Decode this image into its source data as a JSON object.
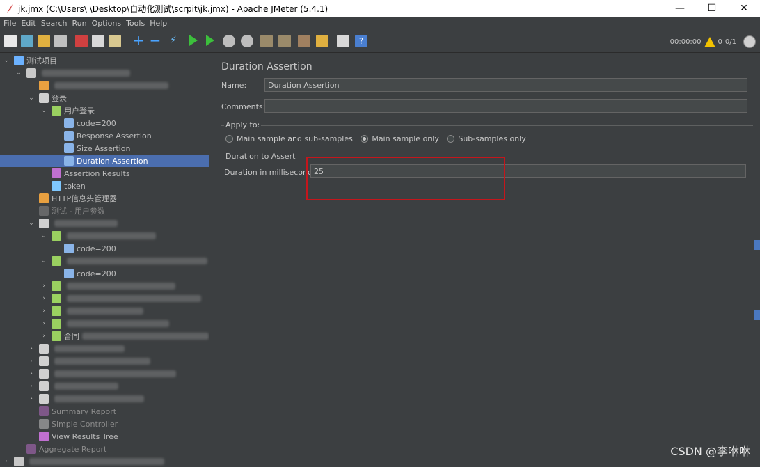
{
  "window": {
    "title": "jk.jmx (C:\\Users\\      \\Desktop\\自动化测试\\scrpit\\jk.jmx) - Apache JMeter (5.4.1)",
    "minimize": "—",
    "maximize": "☐",
    "close": "✕"
  },
  "menu": [
    "File",
    "Edit",
    "Search",
    "Run",
    "Options",
    "Tools",
    "Help"
  ],
  "toolbar": {
    "elapsed": "00:00:00",
    "error_count": "0",
    "threads": "0/1"
  },
  "tree": {
    "items": [
      {
        "label": "测试项目",
        "level": 0,
        "chev": "v",
        "icon": "test-plan-icon"
      },
      {
        "label": "",
        "level": 1,
        "chev": "v",
        "icon": "gear-icon",
        "blurred": true
      },
      {
        "label": "",
        "level": 2,
        "chev": "",
        "icon": "config-icon",
        "blurred": true
      },
      {
        "label": "登录",
        "level": 2,
        "chev": "v",
        "icon": "controller-icon"
      },
      {
        "label": "用户登录",
        "level": 3,
        "chev": "v",
        "icon": "sampler-icon"
      },
      {
        "label": "code=200",
        "level": 4,
        "chev": "",
        "icon": "assertion-icon"
      },
      {
        "label": "Response Assertion",
        "level": 4,
        "chev": "",
        "icon": "assertion-icon"
      },
      {
        "label": "Size Assertion",
        "level": 4,
        "chev": "",
        "icon": "assertion-icon"
      },
      {
        "label": "Duration Assertion",
        "level": 4,
        "chev": "",
        "icon": "assertion-icon",
        "selected": true
      },
      {
        "label": "Assertion Results",
        "level": 3,
        "chev": "",
        "icon": "listener-icon"
      },
      {
        "label": "token",
        "level": 3,
        "chev": "",
        "icon": "extractor-icon"
      },
      {
        "label": "HTTP信息头管理器",
        "level": 2,
        "chev": "",
        "icon": "config-icon"
      },
      {
        "label": "测试 - 用户参数",
        "level": 2,
        "chev": "",
        "icon": "preprocessor-icon",
        "disabled": true
      },
      {
        "label": "",
        "level": 2,
        "chev": "v",
        "icon": "controller-icon",
        "blurred": true
      },
      {
        "label": "",
        "level": 3,
        "chev": "v",
        "icon": "sampler-icon",
        "blurred": true
      },
      {
        "label": "code=200",
        "level": 4,
        "chev": "",
        "icon": "assertion-icon"
      },
      {
        "label": "",
        "level": 3,
        "chev": "v",
        "icon": "sampler-icon",
        "blurred": true
      },
      {
        "label": "code=200",
        "level": 4,
        "chev": "",
        "icon": "assertion-icon"
      },
      {
        "label": "",
        "level": 3,
        "chev": ">",
        "icon": "sampler-icon",
        "blurred": true
      },
      {
        "label": "",
        "level": 3,
        "chev": ">",
        "icon": "sampler-icon",
        "blurred": true
      },
      {
        "label": "",
        "level": 3,
        "chev": ">",
        "icon": "sampler-icon",
        "blurred": true
      },
      {
        "label": "",
        "level": 3,
        "chev": ">",
        "icon": "sampler-icon",
        "blurred": true
      },
      {
        "label": "合同",
        "level": 3,
        "chev": ">",
        "icon": "sampler-icon",
        "blurred": true
      },
      {
        "label": "",
        "level": 2,
        "chev": ">",
        "icon": "controller-icon",
        "blurred": true
      },
      {
        "label": "",
        "level": 2,
        "chev": ">",
        "icon": "controller-icon",
        "blurred": true
      },
      {
        "label": "",
        "level": 2,
        "chev": ">",
        "icon": "controller-icon",
        "blurred": true
      },
      {
        "label": "",
        "level": 2,
        "chev": ">",
        "icon": "controller-icon",
        "blurred": true
      },
      {
        "label": "",
        "level": 2,
        "chev": ">",
        "icon": "controller-icon",
        "blurred": true
      },
      {
        "label": "Summary Report",
        "level": 2,
        "chev": "",
        "icon": "listener-icon",
        "disabled": true
      },
      {
        "label": "Simple Controller",
        "level": 2,
        "chev": "",
        "icon": "controller-icon",
        "disabled": true
      },
      {
        "label": "View Results Tree",
        "level": 2,
        "chev": "",
        "icon": "listener-icon"
      },
      {
        "label": "Aggregate Report",
        "level": 1,
        "chev": "",
        "icon": "listener-icon",
        "disabled": true
      },
      {
        "label": "",
        "level": 0,
        "chev": ">",
        "icon": "gear-icon",
        "blurred": true
      }
    ]
  },
  "panel": {
    "title": "Duration Assertion",
    "name_label": "Name:",
    "name_value": "Duration Assertion",
    "comments_label": "Comments:",
    "comments_value": "",
    "apply_to_label": "Apply to:",
    "apply_options": [
      {
        "label": "Main sample and sub-samples",
        "checked": false
      },
      {
        "label": "Main sample only",
        "checked": true
      },
      {
        "label": "Sub-samples only",
        "checked": false
      }
    ],
    "duration_group_label": "Duration to Assert",
    "duration_label": "Duration in milliseconds:",
    "duration_value": "25"
  },
  "watermark": "CSDN @李咻咻"
}
